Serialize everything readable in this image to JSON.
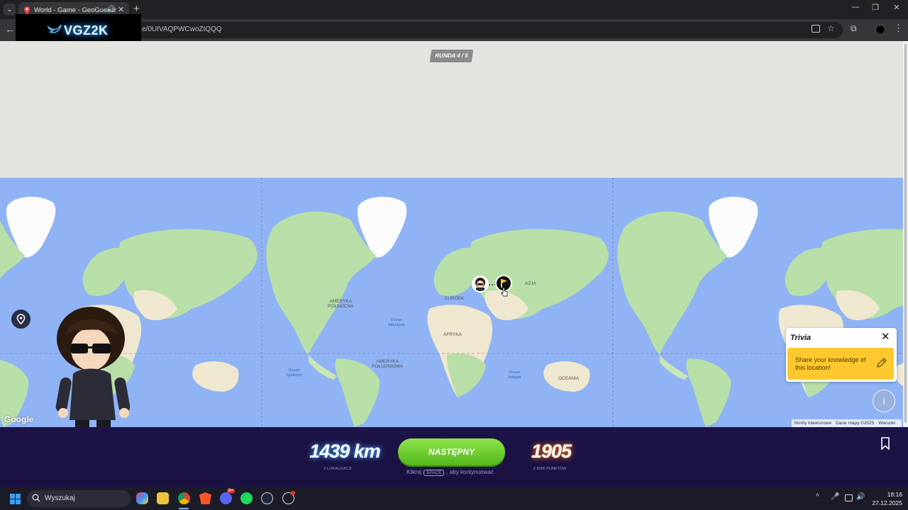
{
  "browser": {
    "tab_title": "World - Game - GeoGuessr",
    "tab_audio": "🔊",
    "tab_close": "✕",
    "new_tab": "+",
    "url": "e/0UIVAQPWCwoZIQQQ",
    "win_minimize": "—",
    "win_restore": "❐",
    "win_close": "✕",
    "back": "←",
    "star": "☆",
    "extensions": "⧉",
    "menu": "⋮",
    "tab_switch": "⌄"
  },
  "overlay_logo": {
    "text": "VGZ2K"
  },
  "game": {
    "round_label": "RUNDA 4 / 5",
    "map_labels": {
      "north_america": "AMERYKA\nPÓŁNOCNA",
      "south_america": "AMERYKA\nPOŁUDNIOWA",
      "europe": "EUROPA",
      "africa": "AFRYKA",
      "asia": "AZJA",
      "oceania": "OCEANIA",
      "atlantic": "Ocean\nAtlantycki",
      "pacific": "Ocean\nSpokojny",
      "indian": "Ocean\nIndyjski"
    },
    "google_logo": "Google",
    "attribution": {
      "shortcuts": "Skróty klawiszowe",
      "map_data": "Dane mapy ©2025",
      "terms": "Warunki"
    },
    "trivia": {
      "title": "Trivia",
      "close": "✕",
      "prompt": "Share your knowledge of this location!"
    },
    "info": "i"
  },
  "results": {
    "distance": "1439 km",
    "distance_caption": "Z LOKALIZACJI",
    "next_button": "NASTĘPNY",
    "hint_prefix": "Kliknij",
    "hint_key": "SPACE",
    "hint_suffix": ", aby kontynuować",
    "points": "1905",
    "points_caption": "Z 5000 PUNKTÓW"
  },
  "taskbar": {
    "search_placeholder": "Wyszukaj",
    "time": "18:16",
    "date": "27.12.2025",
    "discord_badge": "9+",
    "tray_chevron": "^",
    "tray_mic": "🎤",
    "tray_volume": "🔊"
  },
  "colors": {
    "ocean": "#8fb3f4",
    "land": "#b8dfa8",
    "next_button": "#6ccb30",
    "trivia_yellow": "#fec92f",
    "results_bg": "#1d1348"
  }
}
